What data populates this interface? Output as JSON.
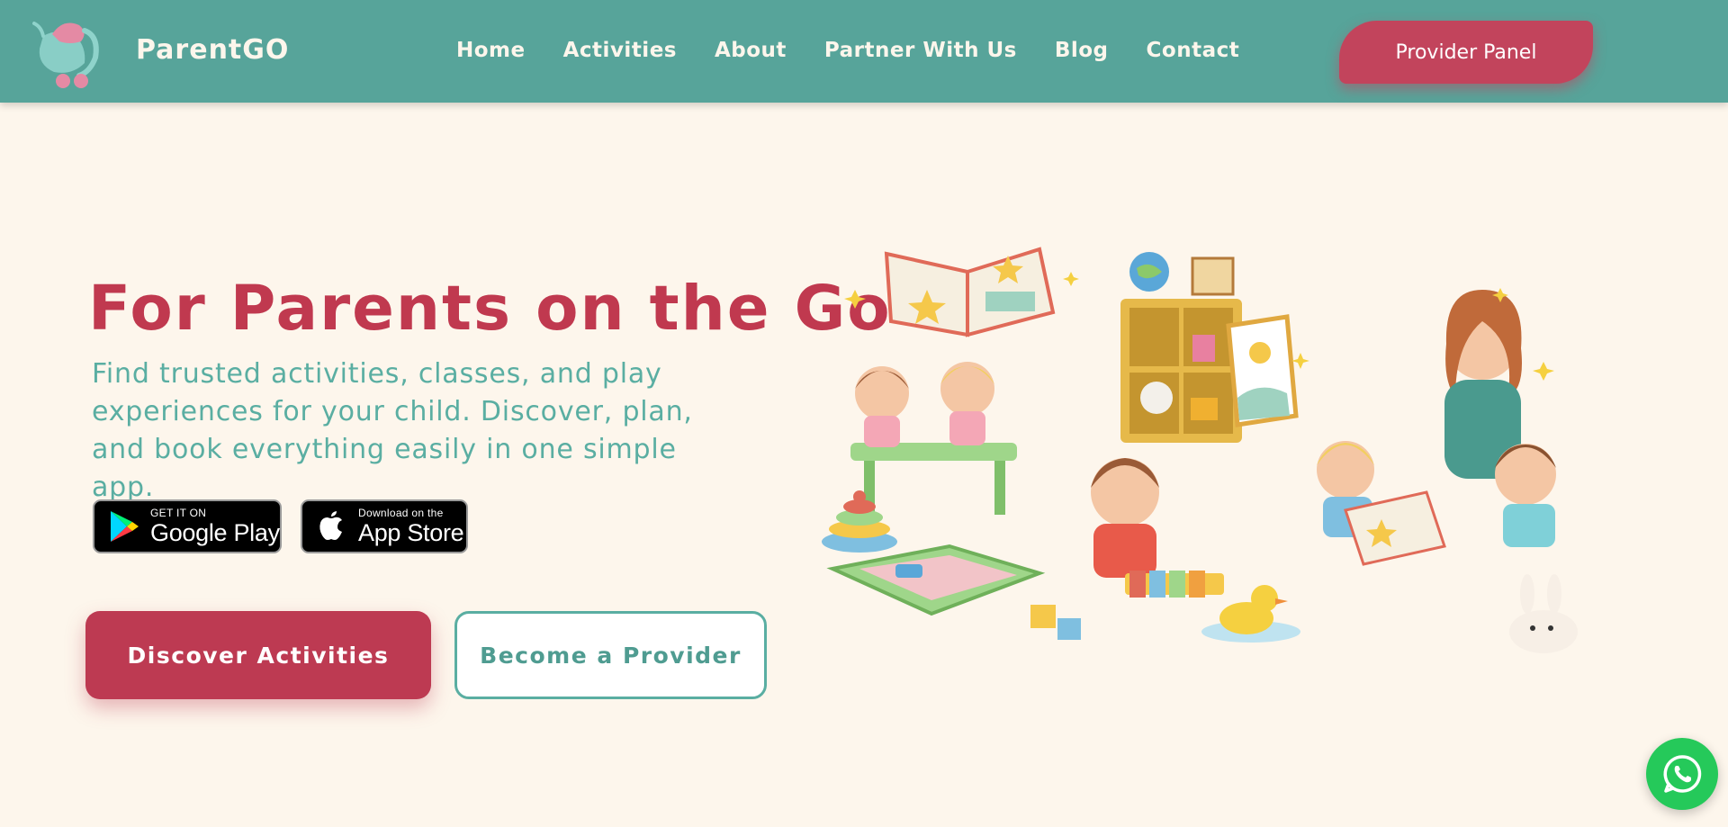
{
  "header": {
    "brand": "ParentGO",
    "logo_icon": "stroller-logo-icon",
    "nav": [
      {
        "label": "Home"
      },
      {
        "label": "Activities"
      },
      {
        "label": "About"
      },
      {
        "label": "Partner With Us"
      },
      {
        "label": "Blog"
      },
      {
        "label": "Contact"
      }
    ],
    "provider_panel_label": "Provider Panel"
  },
  "hero": {
    "title": "For Parents on the Go",
    "subtitle": "Find trusted activities, classes, and play experiences for your child. Discover, plan, and book everything easily in one simple app.",
    "google_play": {
      "small": "GET IT ON",
      "big": "Google Play",
      "icon": "google-play-icon"
    },
    "app_store": {
      "small": "Download on the",
      "big": "App Store",
      "icon": "apple-icon"
    },
    "discover_label": "Discover Activities",
    "provider_label": "Become a Provider",
    "illustration": "kids-playroom-illustration"
  },
  "floating": {
    "whatsapp_icon": "whatsapp-icon"
  },
  "colors": {
    "nav_bg": "#57a49a",
    "page_bg": "#fdf6ec",
    "accent_red": "#c0394f",
    "teal_text": "#5aaea2",
    "whatsapp_green": "#25c95a"
  }
}
